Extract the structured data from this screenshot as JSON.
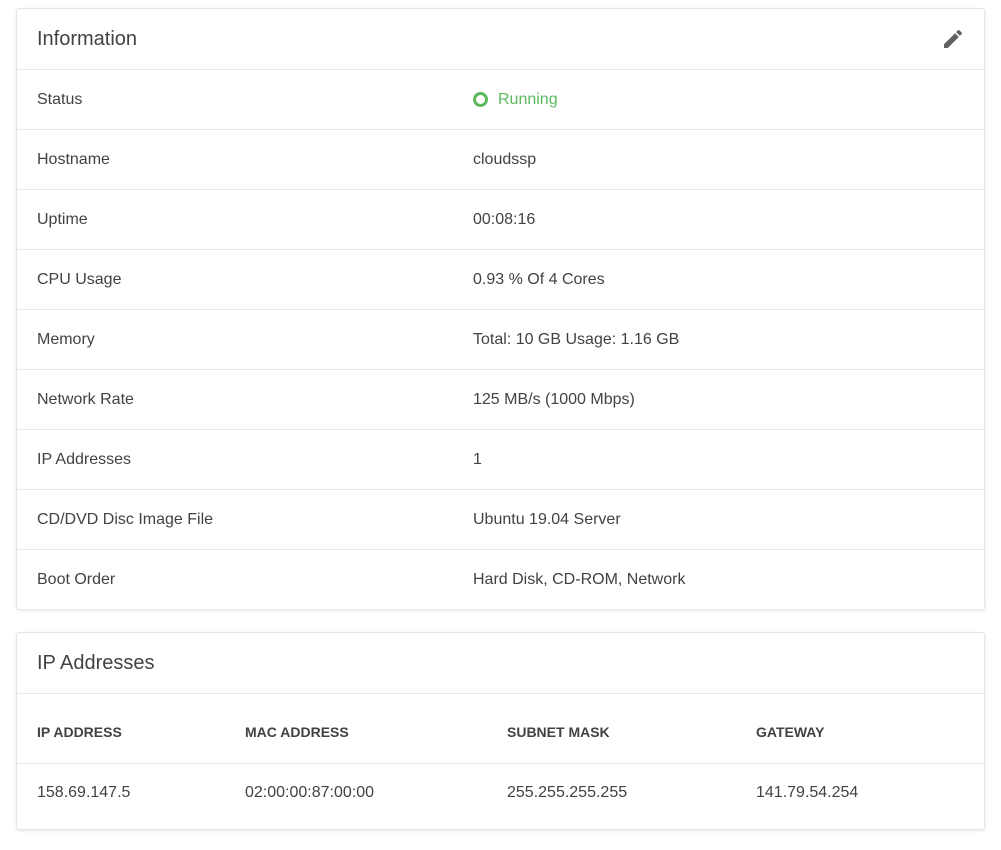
{
  "information": {
    "title": "Information",
    "edit_icon": "pencil-icon",
    "rows": [
      {
        "label": "Status",
        "value": "Running"
      },
      {
        "label": "Hostname",
        "value": "cloudssp"
      },
      {
        "label": "Uptime",
        "value": "00:08:16"
      },
      {
        "label": "CPU Usage",
        "value": "0.93 % Of 4 Cores"
      },
      {
        "label": "Memory",
        "value": "Total: 10 GB Usage: 1.16 GB"
      },
      {
        "label": "Network Rate",
        "value": "125 MB/s (1000 Mbps)"
      },
      {
        "label": "IP Addresses",
        "value": "1"
      },
      {
        "label": "CD/DVD Disc Image File",
        "value": "Ubuntu 19.04 Server"
      },
      {
        "label": "Boot Order",
        "value": "Hard Disk, CD-ROM, Network"
      }
    ],
    "status_color": "#5cb85c"
  },
  "ip_addresses": {
    "title": "IP Addresses",
    "columns": [
      "IP ADDRESS",
      "MAC ADDRESS",
      "SUBNET MASK",
      "GATEWAY"
    ],
    "rows": [
      [
        "158.69.147.5",
        "02:00:00:87:00:00",
        "255.255.255.255",
        "141.79.54.254"
      ]
    ]
  }
}
